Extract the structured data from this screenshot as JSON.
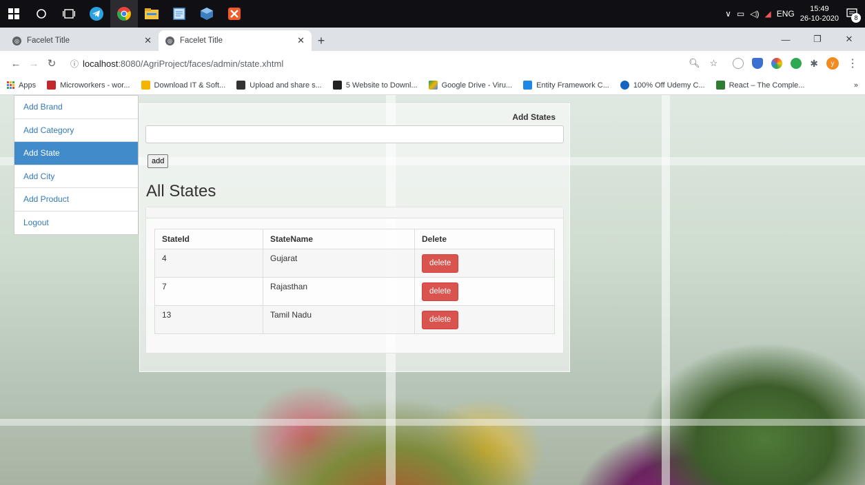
{
  "taskbar": {
    "time": "15:49",
    "date": "26-10-2020",
    "language": "ENG",
    "notification_count": "8",
    "apps": [
      {
        "icon": "windows-start-icon",
        "color": "#ffffff"
      },
      {
        "icon": "search-circle-icon",
        "color": "#ffffff"
      },
      {
        "icon": "task-view-icon",
        "color": "#ffffff"
      },
      {
        "icon": "telegram-icon",
        "color": "#2aa3e0"
      },
      {
        "icon": "chrome-icon",
        "color": "#e8453c"
      },
      {
        "icon": "file-explorer-icon",
        "color": "#f5c542"
      },
      {
        "icon": "notepad-icon",
        "color": "#4a8fd8"
      },
      {
        "icon": "virtualbox-icon",
        "color": "#3d7ebf"
      },
      {
        "icon": "xampp-icon",
        "color": "#f35a2a"
      }
    ]
  },
  "browser": {
    "tabs": [
      {
        "title": "Facelet Title",
        "active": false
      },
      {
        "title": "Facelet Title",
        "active": true
      }
    ],
    "new_tab": "+",
    "url_host": "localhost",
    "url_path": ":8080/AgriProject/faces/admin/state.xhtml",
    "avatar_letter": "y",
    "bookmarks": [
      {
        "label": "Apps",
        "color": "#4285f4"
      },
      {
        "label": "Microworkers - wor...",
        "color": "#c1272d"
      },
      {
        "label": "Download IT & Soft...",
        "color": "#f4b400"
      },
      {
        "label": "Upload and share s...",
        "color": "#333333"
      },
      {
        "label": "5 Website to Downl...",
        "color": "#222222"
      },
      {
        "label": "Google Drive - Viru...",
        "color": "#0f9d58"
      },
      {
        "label": "Entity Framework C...",
        "color": "#1e88e5"
      },
      {
        "label": "100% Off Udemy C...",
        "color": "#1565c0"
      },
      {
        "label": "React – The Comple...",
        "color": "#2e7d32"
      }
    ],
    "bookmarks_more": "»"
  },
  "sidebar": {
    "items": [
      {
        "label": "Add Brand",
        "active": false
      },
      {
        "label": "Add Category",
        "active": false
      },
      {
        "label": "Add State",
        "active": true
      },
      {
        "label": "Add City",
        "active": false
      },
      {
        "label": "Add Product",
        "active": false
      },
      {
        "label": "Logout",
        "active": false
      }
    ]
  },
  "form": {
    "title": "Add States",
    "input_value": "",
    "add_button": "add"
  },
  "list": {
    "title": "All States",
    "columns": [
      "StateId",
      "StateName",
      "Delete"
    ],
    "rows": [
      {
        "id": "4",
        "name": "Gujarat",
        "action": "delete"
      },
      {
        "id": "7",
        "name": "Rajasthan",
        "action": "delete"
      },
      {
        "id": "13",
        "name": "Tamil Nadu",
        "action": "delete"
      }
    ]
  },
  "colors": {
    "active_menu": "#428bca",
    "delete_button": "#d9534f",
    "link": "#337ab7"
  }
}
